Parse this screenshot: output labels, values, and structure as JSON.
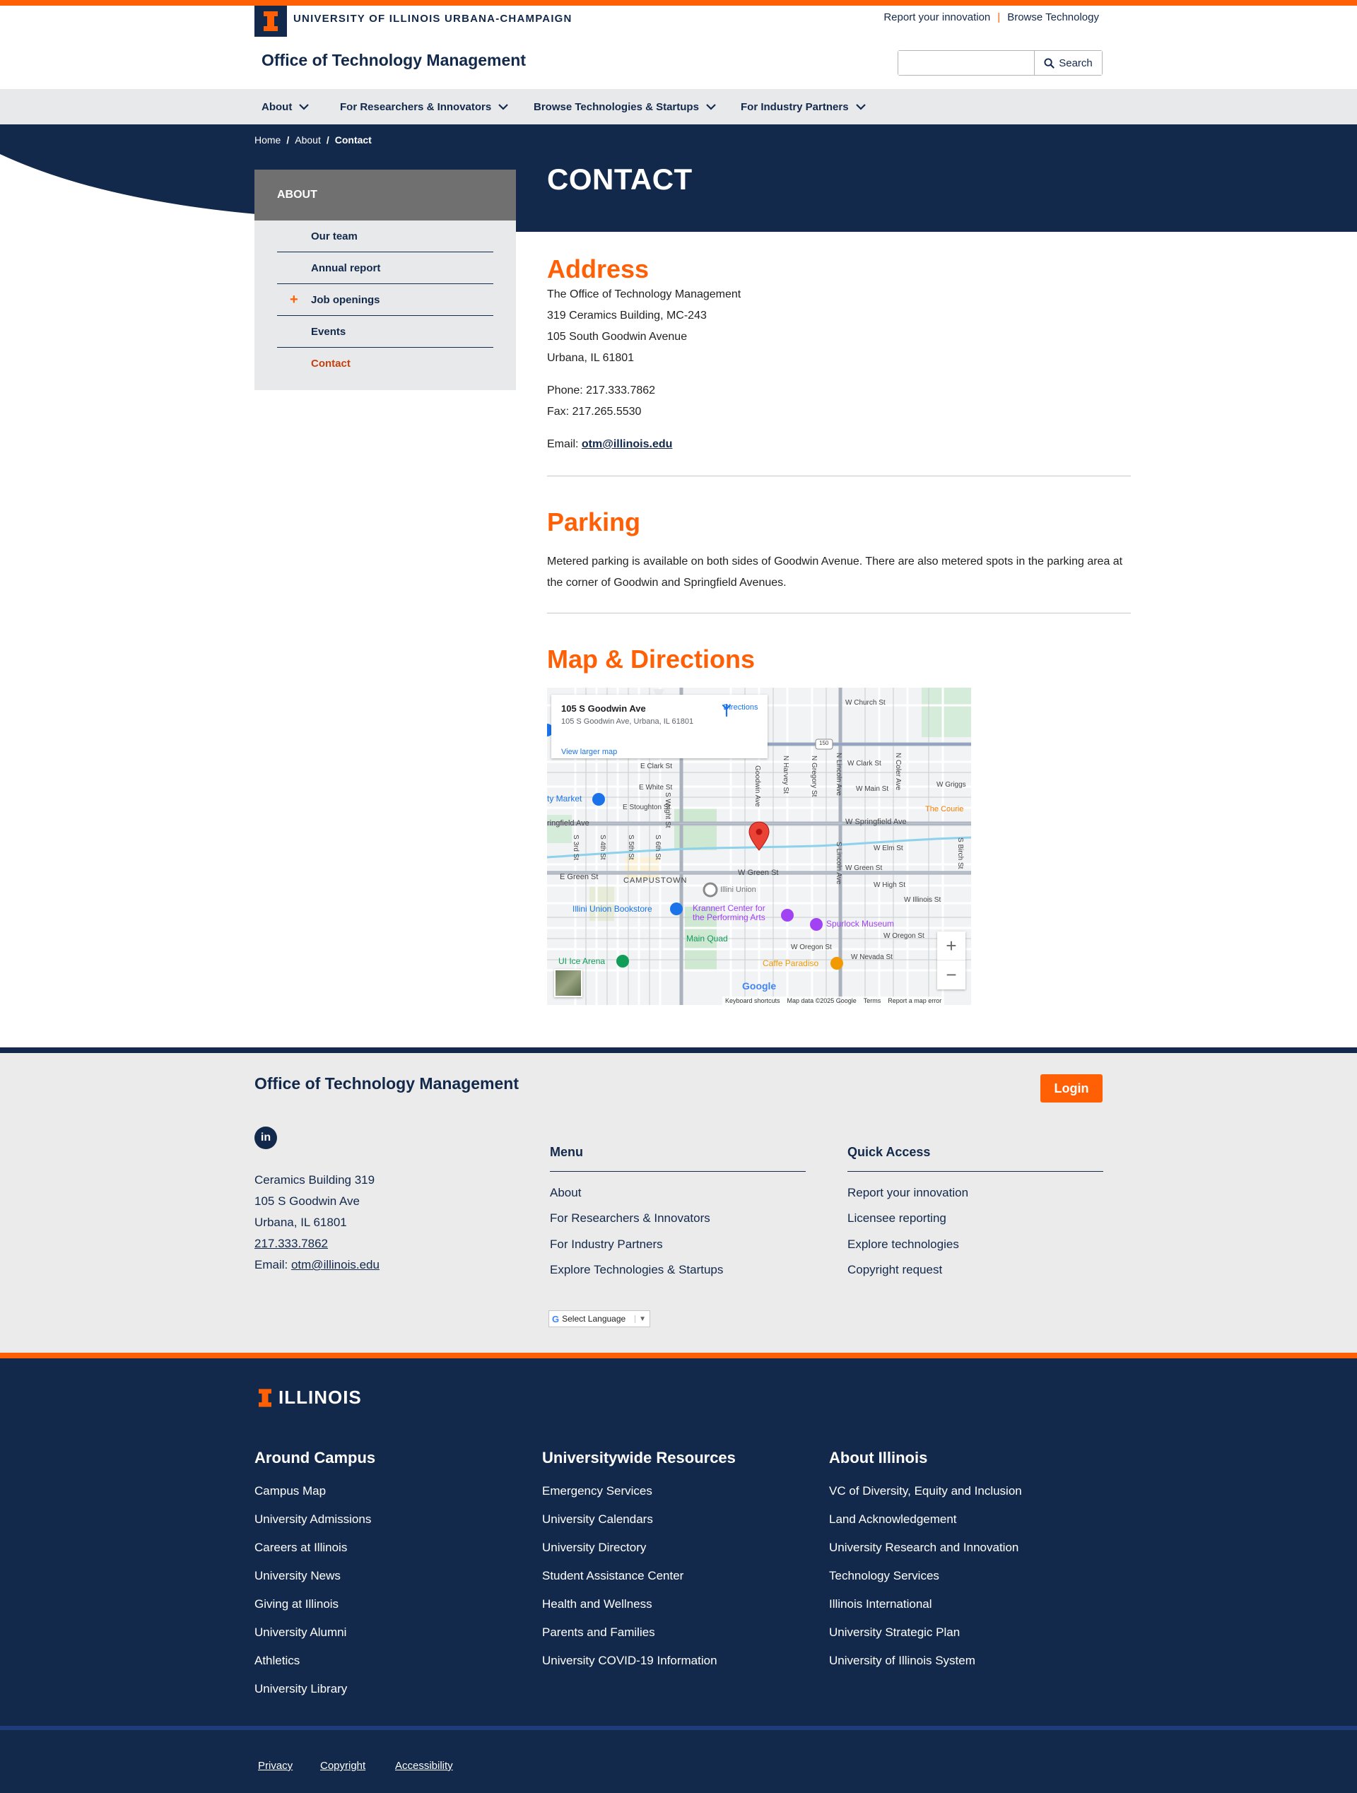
{
  "header": {
    "university": "UNIVERSITY OF ILLINOIS URBANA-CHAMPAIGN",
    "util_links": [
      "Report your innovation",
      "Browse Technology"
    ],
    "site_title": "Office of Technology Management",
    "search": {
      "placeholder": "",
      "button": "Search"
    }
  },
  "nav": [
    "About",
    "For Researchers & Innovators",
    "Browse Technologies & Startups",
    "For Industry Partners"
  ],
  "breadcrumb": [
    "Home",
    "About",
    "Contact"
  ],
  "page_title": "CONTACT",
  "sidebar": {
    "heading": "ABOUT",
    "items": [
      {
        "label": "Our team",
        "expandable": false,
        "active": false
      },
      {
        "label": "Annual report",
        "expandable": false,
        "active": false
      },
      {
        "label": "Job openings",
        "expandable": true,
        "active": false
      },
      {
        "label": "Events",
        "expandable": false,
        "active": false
      },
      {
        "label": "Contact",
        "expandable": false,
        "active": true
      }
    ]
  },
  "address": {
    "heading": "Address",
    "lines": [
      "The Office of Technology Management",
      "319 Ceramics Building, MC-243",
      "105 South Goodwin Avenue",
      "Urbana, IL 61801"
    ],
    "phone": "Phone: 217.333.7862",
    "fax": "Fax: 217.265.5530",
    "email_label": "Email: ",
    "email": "otm@illinois.edu"
  },
  "parking": {
    "heading": "Parking",
    "text": "Metered parking is available on both sides of Goodwin Avenue. There are also metered spots in the parking area at the corner of Goodwin and Springfield Avenues."
  },
  "map": {
    "heading": "Map & Directions",
    "card_title": "105 S Goodwin Ave",
    "card_address": "105 S Goodwin Ave, Urbana, IL 61801",
    "directions": "Directions",
    "larger_map": "View larger map",
    "google": "Google",
    "attribution": [
      "Keyboard shortcuts",
      "Map data ©2025 Google",
      "Terms",
      "Report a map error"
    ],
    "labels": {
      "w_church": "W Church St",
      "e_clark": "E Clark St",
      "w_clark": "W Clark St",
      "e_white": "E White St",
      "w_main": "W Main St",
      "w_griggs": "W Griggs",
      "market": "ty Market",
      "e_stoughton": "E Stoughton St",
      "springfield_w": "ringfield Ave",
      "w_springfield": "W Springfield Ave",
      "courier": "The Courie",
      "w_elm": "W Elm St",
      "w_green": "W Green St",
      "w_green_e": "W Green St",
      "e_green": "E Green St",
      "campustown": "CAMPUSTOWN",
      "illini_union": "Illini Union",
      "w_high": "W High St",
      "w_illinois": "W Illinois St",
      "bookstore": "Illini Union Bookstore",
      "krannert": "Krannert Center for\nthe Performing Arts",
      "spurlock": "Spurlock Museum",
      "w_oregon": "W Oregon St",
      "w_oregon2": "W Oregon St",
      "main_quad": "Main Quad",
      "w_nevada": "W Nevada St",
      "ice_arena": "UI Ice Arena",
      "caffe": "Caffe Paradiso",
      "s_wright": "S Wright St",
      "goodwin": "Goodwin Ave",
      "n_harvey": "N Harvey St",
      "n_gregory": "N Gregory St",
      "n_lincoln": "N Lincoln Ave",
      "s_lincoln": "S Lincoln Ave",
      "n_coler": "N Coler Ave",
      "s_birch": "S Birch St",
      "s_3rd": "S 3rd St",
      "s_4th": "S 4th St",
      "s_5th": "S 5th St",
      "s_6th": "S 6th St",
      "rt150": "150"
    }
  },
  "footer": {
    "title": "Office of Technology Management",
    "login": "Login",
    "social": "in",
    "address": [
      "Ceramics Building 319",
      "105 S Goodwin Ave",
      "Urbana, IL 61801"
    ],
    "phone": "217.333.7862",
    "email_label": "Email: ",
    "email": "otm@illinois.edu",
    "menu": {
      "heading": "Menu",
      "links": [
        "About",
        "For Researchers & Innovators",
        "For Industry Partners",
        "Explore Technologies & Startups"
      ]
    },
    "quick": {
      "heading": "Quick Access",
      "links": [
        "Report your innovation",
        "Licensee reporting",
        "Explore technologies",
        "Copyright request"
      ]
    },
    "language": "Select Language"
  },
  "campus_footer": {
    "logo": "ILLINOIS",
    "columns": [
      {
        "heading": "Around Campus",
        "links": [
          "Campus Map",
          "University Admissions",
          "Careers at Illinois",
          "University News",
          "Giving at Illinois",
          "University Alumni",
          "Athletics",
          "University Library"
        ]
      },
      {
        "heading": "Universitywide Resources",
        "links": [
          "Emergency Services",
          "University Calendars",
          "University Directory",
          "Student Assistance Center",
          "Health and Wellness",
          "Parents and Families",
          "University COVID-19 Information"
        ]
      },
      {
        "heading": "About Illinois",
        "links": [
          "VC of Diversity, Equity and Inclusion",
          "Land Acknowledgement",
          "University Research and Innovation",
          "Technology Services",
          "Illinois International",
          "University Strategic Plan",
          "University of Illinois System"
        ]
      }
    ],
    "legal": [
      "Privacy",
      "Copyright",
      "Accessibility"
    ]
  },
  "colors": {
    "navy": "#13294b",
    "orange": "#ff5f05",
    "active": "#c4410d"
  }
}
